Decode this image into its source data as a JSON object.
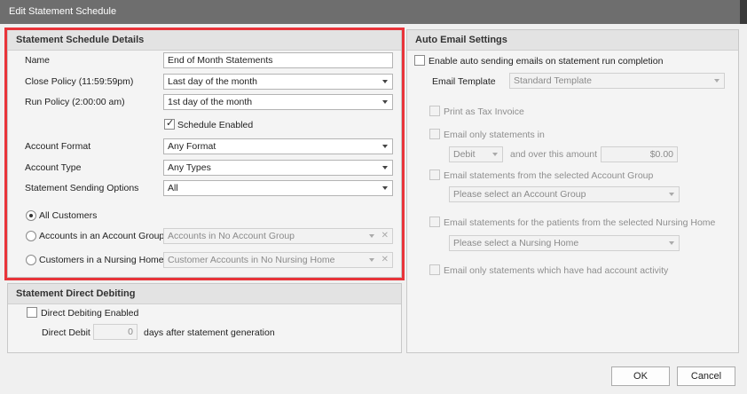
{
  "window": {
    "title": "Edit Statement Schedule"
  },
  "schedule_details": {
    "header": "Statement Schedule Details",
    "name_label": "Name",
    "name_value": "End of Month Statements",
    "close_policy_label": "Close Policy (11:59:59pm)",
    "close_policy_value": "Last day of the month",
    "run_policy_label": "Run Policy (2:00:00 am)",
    "run_policy_value": "1st day of the month",
    "schedule_enabled_label": "Schedule Enabled",
    "schedule_enabled_checked": true,
    "account_format_label": "Account Format",
    "account_format_value": "Any Format",
    "account_type_label": "Account Type",
    "account_type_value": "Any Types",
    "sending_options_label": "Statement Sending Options",
    "sending_options_value": "All",
    "radio_all_customers": "All Customers",
    "radio_account_group": "Accounts in an Account Group",
    "account_group_value": "Accounts in No Account Group",
    "radio_nursing_home": "Customers in a Nursing Home",
    "nursing_home_value": "Customer Accounts in No Nursing Home",
    "selected_radio": "All Customers"
  },
  "direct_debiting": {
    "header": "Statement Direct Debiting",
    "enabled_label": "Direct Debiting Enabled",
    "direct_debit_label": "Direct Debit",
    "days_value": "0",
    "days_suffix": "days after statement generation"
  },
  "auto_email": {
    "header": "Auto Email Settings",
    "enable_label": "Enable auto sending emails on statement run completion",
    "template_label": "Email Template",
    "template_value": "Standard Template",
    "tax_invoice_label": "Print as Tax Invoice",
    "only_statements_in_label": "Email only statements in",
    "debit_value": "Debit",
    "over_amount_label": "and over this amount",
    "amount_value": "$0.00",
    "account_group_label": "Email statements from the selected Account Group",
    "account_group_placeholder": "Please select an Account Group",
    "nursing_home_label": "Email statements for the patients from the selected Nursing Home",
    "nursing_home_placeholder": "Please select a Nursing Home",
    "activity_label": "Email only statements which have had account activity"
  },
  "buttons": {
    "ok": "OK",
    "cancel": "Cancel"
  },
  "colors": {
    "highlight": "#e8343a",
    "titlebar": "#6e6e6e"
  }
}
